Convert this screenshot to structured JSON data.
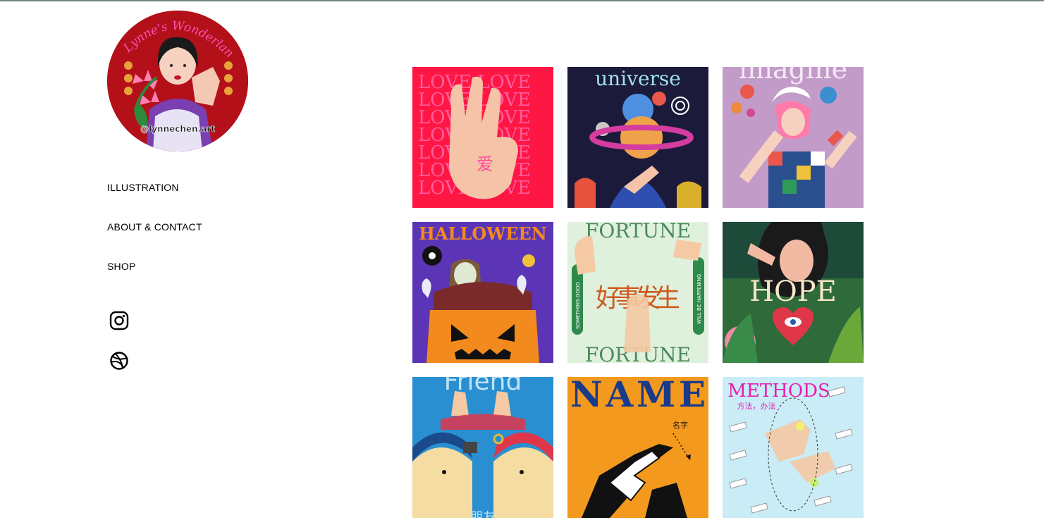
{
  "site": {
    "logo": {
      "lettering": "Lynne's Wonderland",
      "handle": "@lynnechen.art"
    },
    "nav": [
      {
        "label": "ILLUSTRATION"
      },
      {
        "label": "ABOUT & CONTACT"
      },
      {
        "label": "SHOP"
      }
    ],
    "social": [
      {
        "icon": "instagram-icon"
      },
      {
        "icon": "dribbble-icon"
      }
    ],
    "colors": {
      "topline": "#6f8a80",
      "text": "#000000"
    }
  },
  "gallery": {
    "tiles": [
      {
        "lettering": "LOVE LOVE",
        "glyph": "爱",
        "bg": "#ff1744"
      },
      {
        "lettering": "universe",
        "bg": "#1c1a3a"
      },
      {
        "lettering": "imagine",
        "bg": "#c39bc8"
      },
      {
        "lettering": "HALLOWEEN",
        "bg": "#5b35b5"
      },
      {
        "lettering": "FORTUNE",
        "glyph": "好事发生",
        "side_left": "SOMETHING GOOD",
        "side_right": "WILL BE HAPPENING",
        "bg": "#dff0dc"
      },
      {
        "lettering": "HOPE",
        "bg": "#2f6b3a"
      },
      {
        "lettering": "Friend",
        "glyph": "朋友",
        "bg": "#2a8fd0"
      },
      {
        "lettering": "NAME",
        "glyph": "名字",
        "bg": "#f39a1e"
      },
      {
        "lettering": "METHODS",
        "glyph": "方法，办法",
        "bg": "#c9ecf7"
      }
    ]
  }
}
